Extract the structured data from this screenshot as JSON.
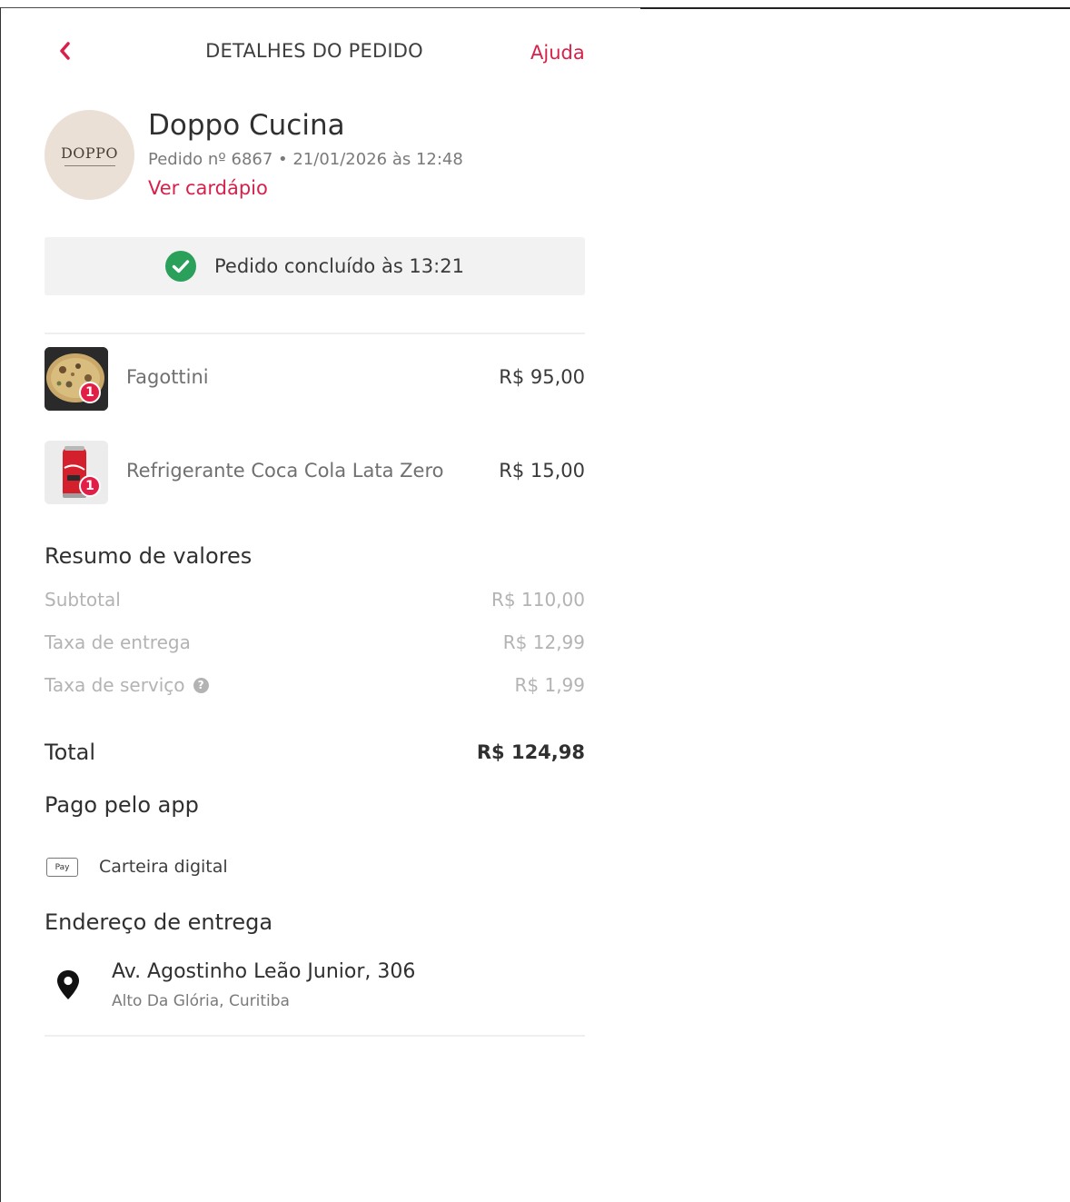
{
  "header": {
    "title": "DETALHES DO PEDIDO",
    "help_label": "Ajuda"
  },
  "store": {
    "logo_text": "DOPPO",
    "name": "Doppo Cucina",
    "order_meta": "Pedido nº 6867 • 21/01/2026 às 12:48",
    "menu_link": "Ver cardápio"
  },
  "status": {
    "text": "Pedido concluído às 13:21",
    "color": "#2aa05a"
  },
  "items": [
    {
      "name": "Fagottini",
      "price": "R$ 95,00",
      "quantity": "1"
    },
    {
      "name": "Refrigerante Coca Cola Lata Zero",
      "price": "R$ 15,00",
      "quantity": "1"
    }
  ],
  "summary": {
    "title": "Resumo de valores",
    "rows": [
      {
        "label": "Subtotal",
        "value": "R$ 110,00"
      },
      {
        "label": "Taxa de entrega",
        "value": "R$ 12,99"
      },
      {
        "label": "Taxa de serviço",
        "value": "R$ 1,99"
      }
    ],
    "total_label": "Total",
    "total_value": "R$ 124,98"
  },
  "payment": {
    "title": "Pago pelo app",
    "icon_text": "Pay",
    "method": "Carteira digital"
  },
  "address": {
    "title": "Endereço de entrega",
    "line1": "Av. Agostinho Leão Junior, 306",
    "line2": "Alto Da Glória, Curitiba"
  },
  "colors": {
    "accent": "#d8214a",
    "badge": "#e21d46"
  }
}
